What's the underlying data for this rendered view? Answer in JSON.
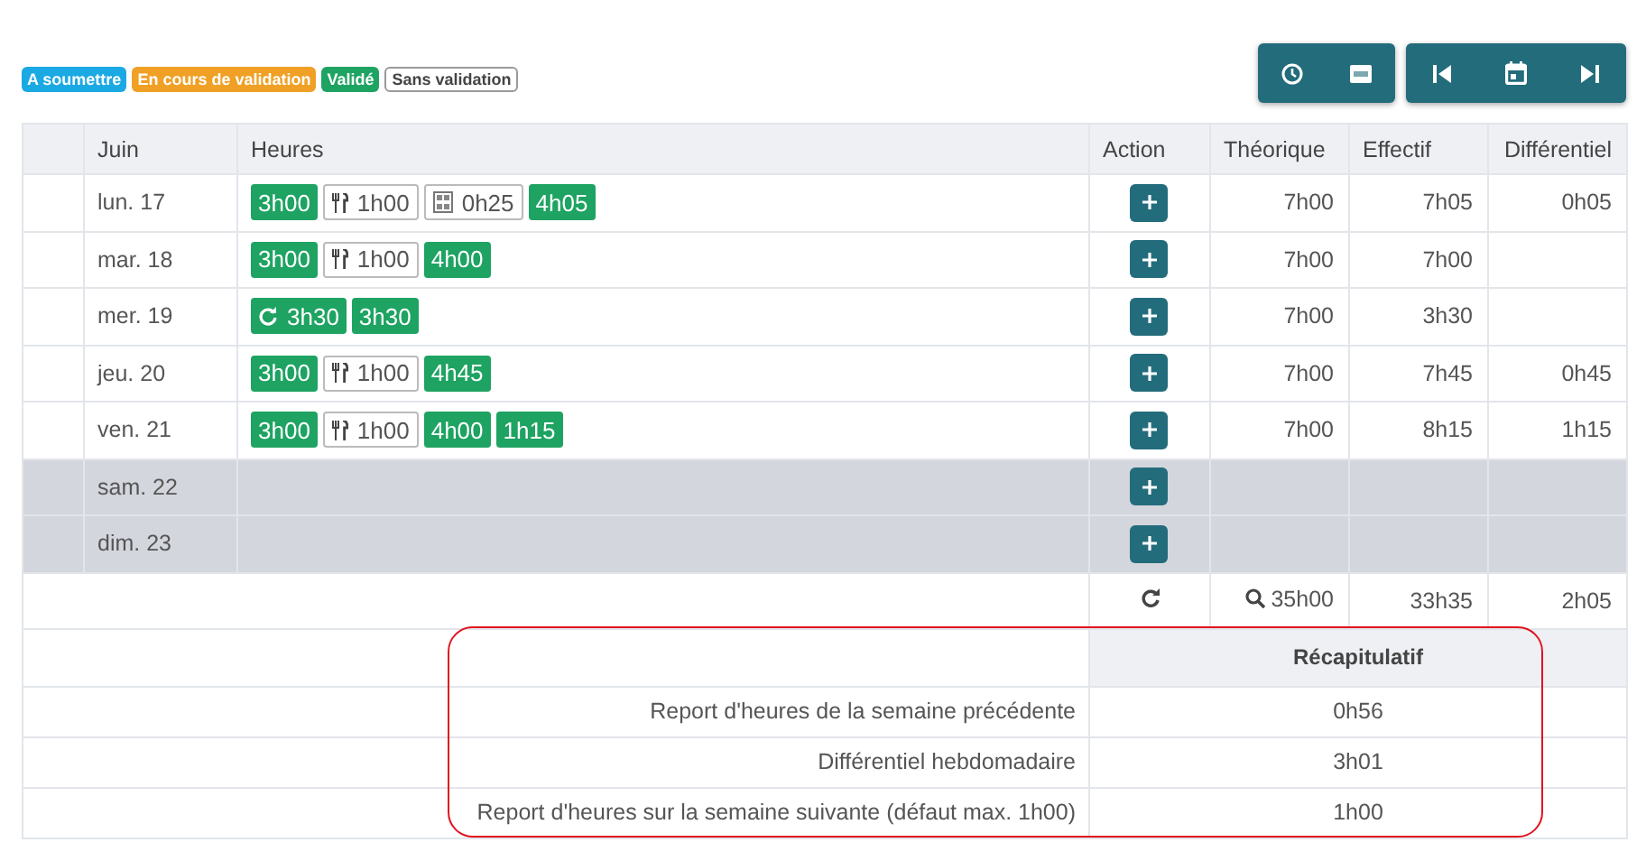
{
  "legend": [
    {
      "label": "A soumettre",
      "kind": "filled",
      "color": "#1aa9e3"
    },
    {
      "label": "En cours de validation",
      "kind": "filled",
      "color": "#f0a024"
    },
    {
      "label": "Validé",
      "kind": "filled",
      "color": "#1ea362"
    },
    {
      "label": "Sans validation",
      "kind": "outline",
      "color": "#9a9a9a"
    }
  ],
  "table": {
    "columns": [
      {
        "label": "Juin"
      },
      {
        "label": "Heures"
      },
      {
        "label": "Action"
      },
      {
        "label": "Théorique"
      },
      {
        "label": "Effectif"
      },
      {
        "label": "Différentiel"
      }
    ],
    "rows": [
      {
        "day": "lun. 17",
        "inactive": false,
        "entries": [
          {
            "kind": "work",
            "text": "3h00"
          },
          {
            "kind": "meal",
            "text": "1h00"
          },
          {
            "kind": "break",
            "text": "0h25"
          },
          {
            "kind": "work",
            "text": "4h05"
          }
        ],
        "theoretical": "7h00",
        "actual": "7h05",
        "difference": "0h05"
      },
      {
        "day": "mar. 18",
        "inactive": false,
        "entries": [
          {
            "kind": "work",
            "text": "3h00"
          },
          {
            "kind": "meal",
            "text": "1h00"
          },
          {
            "kind": "work",
            "text": "4h00"
          }
        ],
        "theoretical": "7h00",
        "actual": "7h00"
      },
      {
        "day": "mer. 19",
        "inactive": false,
        "entries": [
          {
            "kind": "recovery",
            "text": "3h30"
          },
          {
            "kind": "work",
            "text": "3h30"
          }
        ],
        "theoretical": "7h00",
        "actual": "3h30"
      },
      {
        "day": "jeu. 20",
        "inactive": false,
        "entries": [
          {
            "kind": "work",
            "text": "3h00"
          },
          {
            "kind": "meal",
            "text": "1h00"
          },
          {
            "kind": "work",
            "text": "4h45"
          }
        ],
        "theoretical": "7h00",
        "actual": "7h45",
        "difference": "0h45"
      },
      {
        "day": "ven. 21",
        "inactive": false,
        "entries": [
          {
            "kind": "work",
            "text": "3h00"
          },
          {
            "kind": "meal",
            "text": "1h00"
          },
          {
            "kind": "work",
            "text": "4h00"
          },
          {
            "kind": "work",
            "text": "1h15"
          }
        ],
        "theoretical": "7h00",
        "actual": "8h15",
        "difference": "1h15"
      },
      {
        "day": "sam. 22",
        "inactive": true
      },
      {
        "day": "dim. 23",
        "inactive": true
      }
    ],
    "totals": {
      "theoretical": "35h00",
      "actual": "33h35",
      "difference": "2h05"
    }
  },
  "summary": {
    "title": "Récapitulatif",
    "highlighted": true,
    "rows": [
      {
        "label": "Report d'heures de la semaine précédente",
        "value": "0h56"
      },
      {
        "label": "Différentiel hebdomadaire",
        "value": "3h01"
      },
      {
        "label": "Report d'heures sur la semaine suivante (défaut max. 1h00)",
        "value": "1h00"
      }
    ]
  }
}
